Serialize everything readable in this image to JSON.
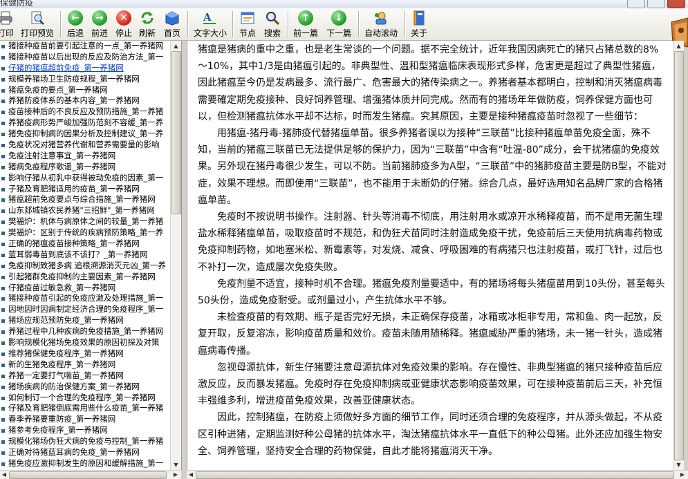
{
  "window": {
    "title": "保健防疫"
  },
  "toolbar": [
    {
      "label": "打印",
      "icon": "print-icon"
    },
    {
      "label": "打印预览",
      "icon": "print-preview-icon"
    },
    {
      "label": "后退",
      "icon": "back-arrow-icon"
    },
    {
      "label": "前进",
      "icon": "forward-arrow-icon"
    },
    {
      "label": "停止",
      "icon": "stop-icon"
    },
    {
      "label": "刷新",
      "icon": "refresh-icon"
    },
    {
      "label": "首页",
      "icon": "home-icon"
    },
    {
      "label": "文字大小",
      "icon": "font-size-icon"
    },
    {
      "label": "节点",
      "icon": "node-icon"
    },
    {
      "label": "搜索",
      "icon": "search-icon"
    },
    {
      "label": "前一篇",
      "icon": "previous-article-icon"
    },
    {
      "label": "下一篇",
      "icon": "next-article-icon"
    },
    {
      "label": "自动滚动",
      "icon": "auto-scroll-icon"
    },
    {
      "label": "关于",
      "icon": "about-icon"
    }
  ],
  "sidebar": {
    "selected_index": 2,
    "items": [
      "猪接种疫苗前要引起注意的一点_第一养猪网",
      "猪接种疫苗以后出现的反应及防治方法_第一",
      "仔猪的猪瘟超前免疫_第一养猪网",
      "规模养猪场卫生防疫规程_第一养猪网",
      "猪瘟免疫的要点_第一养猪网",
      "养猪防疫体系的基本内容_第一养猪网",
      "疫苗接种后的不良反应及预防措施_第一养猪",
      "养猪疫病形势严峻加强防范刻不容缓_第一养",
      "猪免疫抑制病的因果分析及控制建议_第一养",
      "免疫状况对猪营养代谢和营养需要量的影响",
      "免疫注射注意事宜_第一养猪网",
      "猪病免疫程序歌谣_第一养猪网",
      "影响仔猪从初乳中获得被动免疫的因素_第一",
      "子猪及育肥猪适用的疫苗_第一养猪网",
      "猪瘟超前免疫要点与综合措施_第一养猪网",
      "山东郯城镇农民养猪\"三招鲜\"_第一养猪网",
      "樊福炉：机体与病原体之间的较量_第一养猪",
      "樊福炉：区别于传统的疾病预防策略_第一养",
      "正确的猪瘟疫苗接种策略_第一养猪网",
      "蓝耳弱毒苗到底该不该打？_第一养猪网",
      "免疫抑制致猪多病 追根溯源消灭元凶_第一养",
      "引起猪群免疫抑制的主要因素_第一养猪网",
      "仔猪疫苗过敏急救_第一养猪网",
      "猪接种疫苗引起的免疫应激及处理措施_第一",
      "因地因时因病制定经济合理的免疫程序_第一",
      "猪场应规范预防免疫_第一养猪网",
      "养猪过程中几种疾病的免疫措施_第一养猪网",
      "影响规模化猪场免疫效果的原因初探及对策",
      "推荐猪保健免疫程序_第一养猪网",
      "新的生猪免疫程序_第一养猪网",
      "养猪一定要打气喘苗_第一养猪网",
      "猪场疾病的防治保健方案_第一养猪网",
      "如何制订一个合理的免疫程序_第一养猪网",
      "仔猪及育肥猪倒底需用些什么疫苗_第一养猪",
      "春季养猪要重防疫_第一养猪网",
      "猪参考免疫程序_第一养猪网",
      "规模化猪场伪狂犬病的免疫与控制_第一养猪",
      "正确对待猪蓝耳病的免疫_第一养猪网",
      "猪免疫应激抑制发生的原因和缓解措施_第一"
    ]
  },
  "article": {
    "paragraphs": [
      "猪瘟是猪病的重中之重，也是老生常谈的一个问题。据不完全统计，近年我国因病死亡的猪只占猪总数的8%～10%，其中1/3是由猪瘟引起的。非典型性、温和型猪瘟临床表现形式多样，危害更是超过了典型性猪瘟，因此猪瘟至今仍是发病最多、流行最广、危害最大的猪传染病之一。养猪者基本都明白，控制和消灭猪瘟病毒需要確定期免疫接种、良好饲养管理、增强猪体质并同完成。然而有的猪场年年做防疫，饲养保健方面也可以，但检测猪瘟抗体水平却不达标，时而发生猪瘟。究其原因，主要是接种猪瘟疫苗时忽视了一些细节：",
      "用猪瘟-猪丹毒-猪肺疫代替猪瘟单苗。很多养猪者误以为接种“三联苗”比接种猪瘟单苗免疫全面，殊不知，当前的猪瘟三联苗已无法提供足够的保护力，因为“三联苗”中含有“吐温-80”成分，会干扰猪瘟的免疫效果。另外现在猪丹毒很少发生，可以不防。当前猪肺疫多为A型，“三联苗”中的猪肺疫苗主要是防B型，不能对症，效果不理想。而即使用“三联苗”，也不能用于未断奶的仔猪。综合几点，最好选用知名品牌厂家的合格猪瘟单苗。",
      "免疫时不按说明书操作。注射器、针头等消毒不彻底，用注射用水或凉开水稀释疫苗，而不是用无菌生理盐水稀释猪瘟单苗，吸取疫苗时不规范，和伪狂犬苗同时注射造成免疫干扰，免疫前后三天使用抗病毒药物或免疫抑制药物，如地塞米松、新霉素等，对发烧、减食、呼吸困难的有病猪只也注射疫苗，或打飞针，过后也不补打一次，造成屡次免疫失败。",
      "免疫剂量不适宜，接种时机不合理。猪瘟免疫剂量要适中，有的猪场将每头猪瘟苗用到10头份，甚至每头50头份，造成免疫耐受。或剂量过小，产生抗体水平不够。",
      "未检查疫苗的有效期、瓶子是否完好无损，未正确保存疫苗，冰箱或冰柜非专用，常和鱼、肉一起放，反复开取，反复溶冻，影响疫苗质量和效价。疫苗未随用随稀释。猪瘟威胁严重的猪场，未一猪一针头，造成猪瘟病毒传播。",
      "忽视母源抗体，新生仔猪要注意母源抗体对免疫效果的影响。存在慢性、非典型猪瘟的猪只接种疫苗后应激反应，反而暴发猪瘟。免疫时存在免疫抑制病或亚健康状态影响疫苗效果，可在接种疫苗前后三天，补充恒丰强维多利，增进疫苗免疫效果，改善亚健康状态。",
      "因此，控制猪瘟，在防疫上须做好多方面的细节工作，同时还须合理的免疫程序，并从源头做起，不从疫区引种进猪，定期监测好种公母猪的抗体水平，淘汰猪瘟抗体水平一直低下的种公母猪。此外还应加强生物安全、饲养管理，坚持安全合理的药物保健，自此才能将猪瘟消灭干净。"
    ]
  }
}
